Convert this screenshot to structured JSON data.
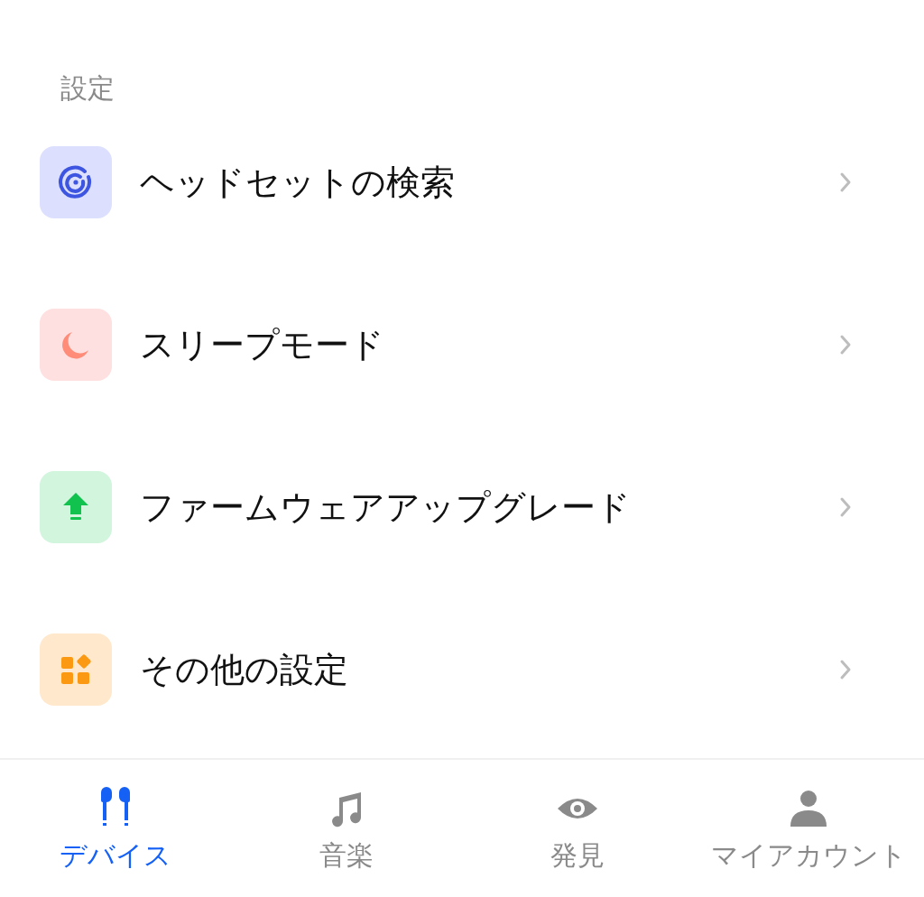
{
  "section_title": "設定",
  "settings": [
    {
      "kind": "search",
      "label": "ヘッドセットの検索"
    },
    {
      "kind": "sleep",
      "label": "スリープモード"
    },
    {
      "kind": "upgrade",
      "label": "ファームウェアアップグレード"
    },
    {
      "kind": "more",
      "label": "その他の設定"
    }
  ],
  "tabs": [
    {
      "kind": "device",
      "label": "デバイス",
      "selected": true
    },
    {
      "kind": "music",
      "label": "音楽",
      "selected": false
    },
    {
      "kind": "discover",
      "label": "発見",
      "selected": false
    },
    {
      "kind": "account",
      "label": "マイアカウント",
      "selected": false
    }
  ]
}
